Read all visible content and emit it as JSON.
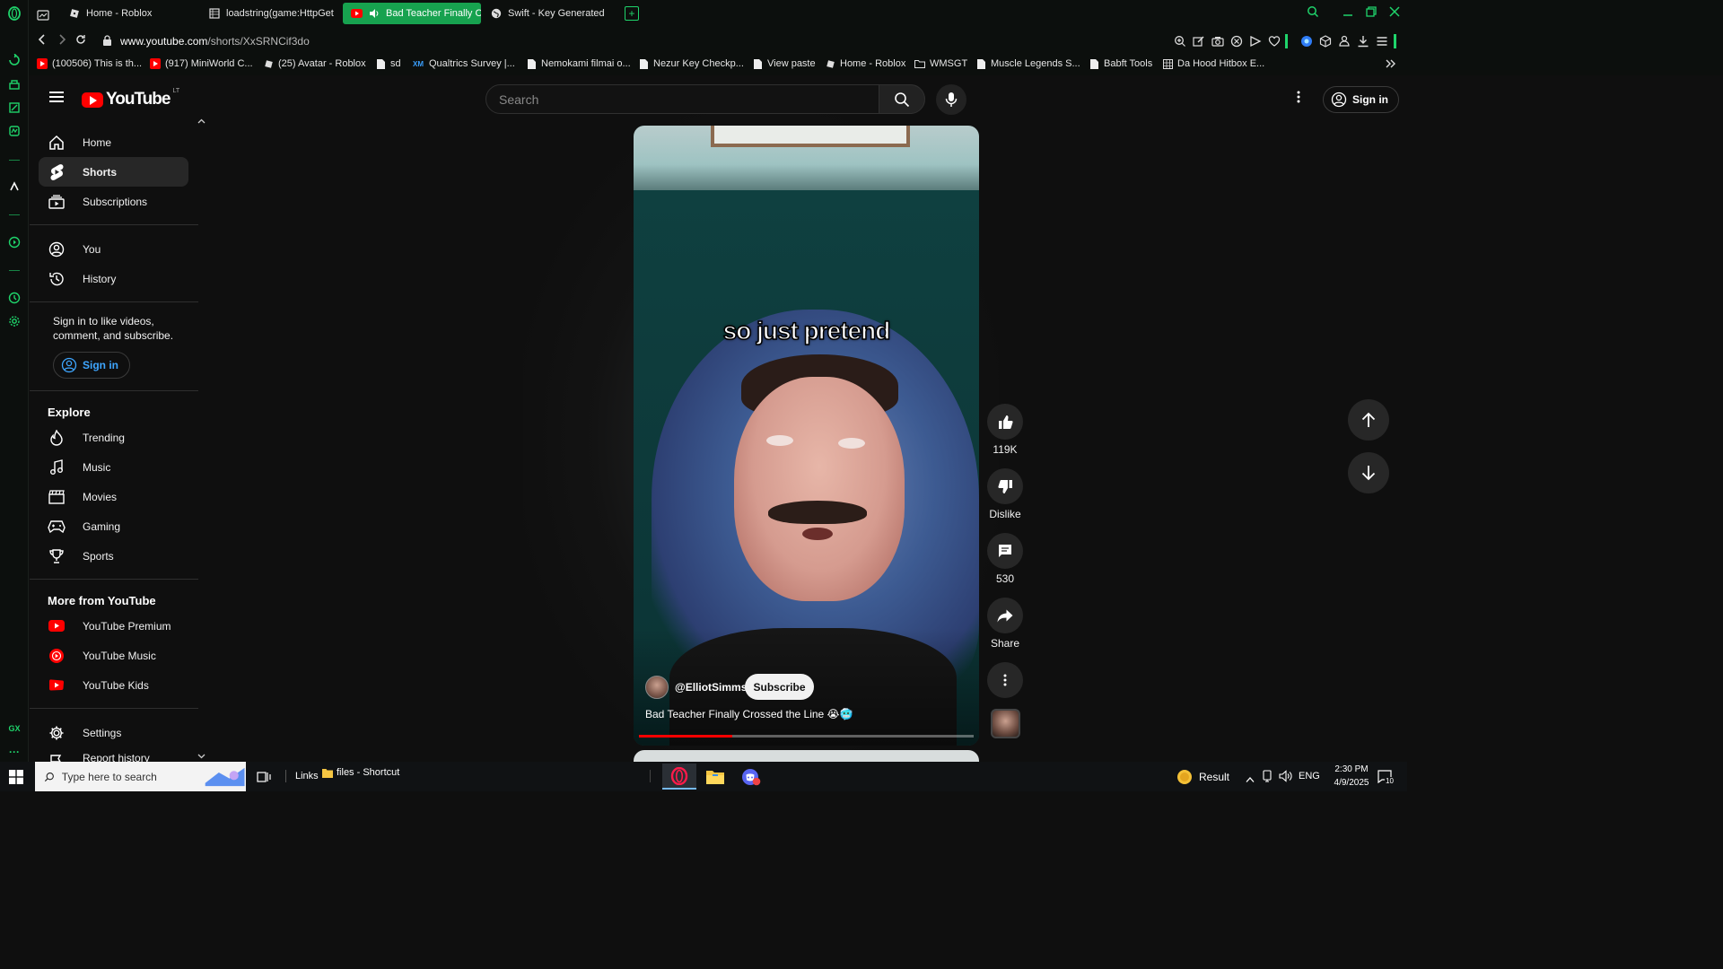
{
  "browser": {
    "tabs": [
      {
        "label": "Home - Roblox"
      },
      {
        "label": "loadstring(game:HttpGet("
      },
      {
        "label": "Bad Teacher Finally Cr"
      },
      {
        "label": "Swift - Key Generated"
      }
    ],
    "new_tab": "+",
    "url_host": "www.youtube.com",
    "url_path": "/shorts/XxSRNCif3do",
    "bookmarks": [
      {
        "label": "(100506) This is th..."
      },
      {
        "label": "(917) MiniWorld C..."
      },
      {
        "label": "(25) Avatar - Roblox"
      },
      {
        "label": "sd"
      },
      {
        "label": "Qualtrics Survey |..."
      },
      {
        "label": "Nemokami filmai o..."
      },
      {
        "label": "Nezur Key Checkp..."
      },
      {
        "label": "View paste"
      },
      {
        "label": "Home - Roblox"
      },
      {
        "label": "WMSGT"
      },
      {
        "label": "Muscle Legends S..."
      },
      {
        "label": "Babft Tools"
      },
      {
        "label": "Da Hood Hitbox E..."
      }
    ],
    "qualtrics_badge": "XM",
    "rail_bottom": "GX",
    "accent": "#1fd46b"
  },
  "youtube": {
    "logo_text": "YouTube",
    "country_code": "LT",
    "search_placeholder": "Search",
    "signin_label": "Sign in",
    "nav_main": [
      {
        "label": "Home"
      },
      {
        "label": "Shorts"
      },
      {
        "label": "Subscriptions"
      }
    ],
    "nav_you": [
      {
        "label": "You"
      },
      {
        "label": "History"
      }
    ],
    "signin_prompt": "Sign in to like videos, comment, and subscribe.",
    "explore_heading": "Explore",
    "explore": [
      {
        "label": "Trending"
      },
      {
        "label": "Music"
      },
      {
        "label": "Movies"
      },
      {
        "label": "Gaming"
      },
      {
        "label": "Sports"
      }
    ],
    "more_heading": "More from YouTube",
    "more": [
      {
        "label": "YouTube Premium"
      },
      {
        "label": "YouTube Music"
      },
      {
        "label": "YouTube Kids"
      }
    ],
    "settings": [
      {
        "label": "Settings"
      },
      {
        "label": "Report history"
      }
    ],
    "brand_red": "#ff0000"
  },
  "short": {
    "caption": "so just pretend",
    "channel": "@ElliotSimms",
    "subscribe_label": "Subscribe",
    "title": "Bad Teacher Finally Crossed the Line 😭🥶",
    "progress": 0.28,
    "likes": "119K",
    "dislike_label": "Dislike",
    "comments": "530",
    "share_label": "Share"
  },
  "taskbar": {
    "search_placeholder": "Type here to search",
    "links_label": "Links",
    "shortcut_label": "files - Shortcut",
    "weather_label": "Result",
    "language": "ENG",
    "time": "2:30 PM",
    "date": "4/9/2025",
    "notifications": "10"
  }
}
